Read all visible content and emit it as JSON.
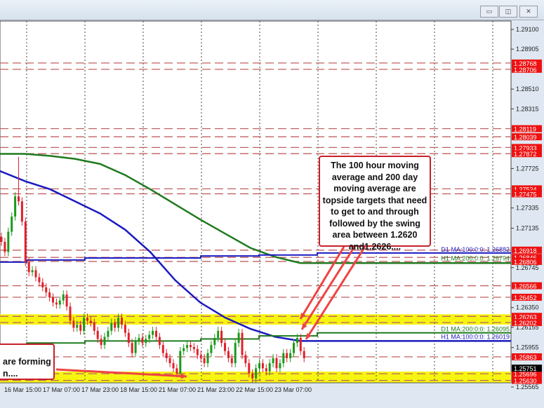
{
  "window": {
    "minimize": "▭",
    "maximize": "◫",
    "close": "✕"
  },
  "colors": {
    "up": "#1a9a1a",
    "down": "#e0202a",
    "level": "#c06060",
    "label_bg": "#ee1111",
    "yellow": "#f5f510",
    "ma_blue": "#1a1ac0",
    "ma_green": "#1f7a1f",
    "current_bg": "#000000"
  },
  "annotations": {
    "main": "The 100 hour moving average and 200 day moving average are topside targets that need to get to and through followed by the swing area between 1.2620 and1.2626....",
    "left_line1": "are forming",
    "left_line2": "n...."
  },
  "chart_data": {
    "type": "candlestick",
    "title": "",
    "ylim": [
      1.2552,
      1.2925
    ],
    "y_ticks": [
      "1.29100",
      "1.28905",
      "1.28510",
      "1.28315",
      "1.27725",
      "1.27335",
      "1.27135",
      "1.26745",
      "1.26350",
      "1.26155",
      "1.25955",
      "1.25565"
    ],
    "x_ticks": [
      "16 Mar 15:00",
      "17 Mar 07:00",
      "17 Mar 23:00",
      "18 Mar 15:00",
      "21 Mar 07:00",
      "21 Mar 23:00",
      "22 Mar 15:00",
      "23 Mar 07:00"
    ],
    "levels": [
      "1.28768",
      "1.28706",
      "1.28119",
      "1.28039",
      "1.27933",
      "1.27872",
      "1.27524",
      "1.27475",
      "1.26918",
      "1.26846",
      "1.26806",
      "1.26566",
      "1.26452",
      "1.26263",
      "1.26202",
      "1.25863",
      "1.25696",
      "1.25630"
    ],
    "yellow_zones": [
      [
        1.26202,
        1.26263
      ],
      [
        1.2563,
        1.25696
      ]
    ],
    "current_price": "1.25751",
    "ma_labels": [
      {
        "text": "D1 MA:100:0:0: 1.26882",
        "value": 1.26882,
        "color": "blue"
      },
      {
        "text": "H1 MA:200:0:0: 1.26794",
        "value": 1.26794,
        "color": "green"
      },
      {
        "text": "D1 MA:200:0:0: 1.26095",
        "value": 1.26095,
        "color": "green"
      },
      {
        "text": "H1 MA:100:0:0: 1.26019",
        "value": 1.26019,
        "color": "blue"
      }
    ],
    "h1_ma200": [
      1.2787,
      1.2787,
      1.2785,
      1.2782,
      1.2777,
      1.2766,
      1.2752,
      1.2737,
      1.2722,
      1.2708,
      1.2694,
      1.2685,
      1.2679
    ],
    "h1_ma100": [
      1.277,
      1.276,
      1.2752,
      1.274,
      1.2728,
      1.2712,
      1.269,
      1.2662,
      1.264,
      1.2625,
      1.2614,
      1.2606,
      1.2602
    ],
    "d1_ma100_steps": [
      1.268,
      1.2682,
      1.2684,
      1.2686,
      1.2687,
      1.2689
    ],
    "d1_ma200_steps": [
      1.2598,
      1.26,
      1.2602,
      1.2604,
      1.2607,
      1.261
    ],
    "closes": [
      1.27,
      1.269,
      1.271,
      1.2725,
      1.2745,
      1.274,
      1.272,
      1.268,
      1.267,
      1.2672,
      1.2665,
      1.266,
      1.2655,
      1.265,
      1.2645,
      1.264,
      1.2638,
      1.2642,
      1.2648,
      1.2636,
      1.2622,
      1.2615,
      1.2618,
      1.2612,
      1.2625,
      1.2622,
      1.262,
      1.2612,
      1.2604,
      1.2598,
      1.2606,
      1.2612,
      1.262,
      1.2615,
      1.2625,
      1.2618,
      1.261,
      1.26,
      1.259,
      1.2602,
      1.2605,
      1.26,
      1.2604,
      1.2608,
      1.2612,
      1.2606,
      1.2598,
      1.259,
      1.2585,
      1.258,
      1.2575,
      1.257,
      1.2592,
      1.2595,
      1.2598,
      1.2596,
      1.2594,
      1.2588,
      1.2585,
      1.258,
      1.259,
      1.2598,
      1.2605,
      1.2612,
      1.26,
      1.2592,
      1.2585,
      1.258,
      1.26,
      1.261,
      1.2588,
      1.258,
      1.257,
      1.2565,
      1.2575,
      1.258,
      1.2575,
      1.2572,
      1.258,
      1.2585,
      1.2575,
      1.258,
      1.259,
      1.2585,
      1.259,
      1.26,
      1.2605,
      1.2592,
      1.2585
    ]
  }
}
